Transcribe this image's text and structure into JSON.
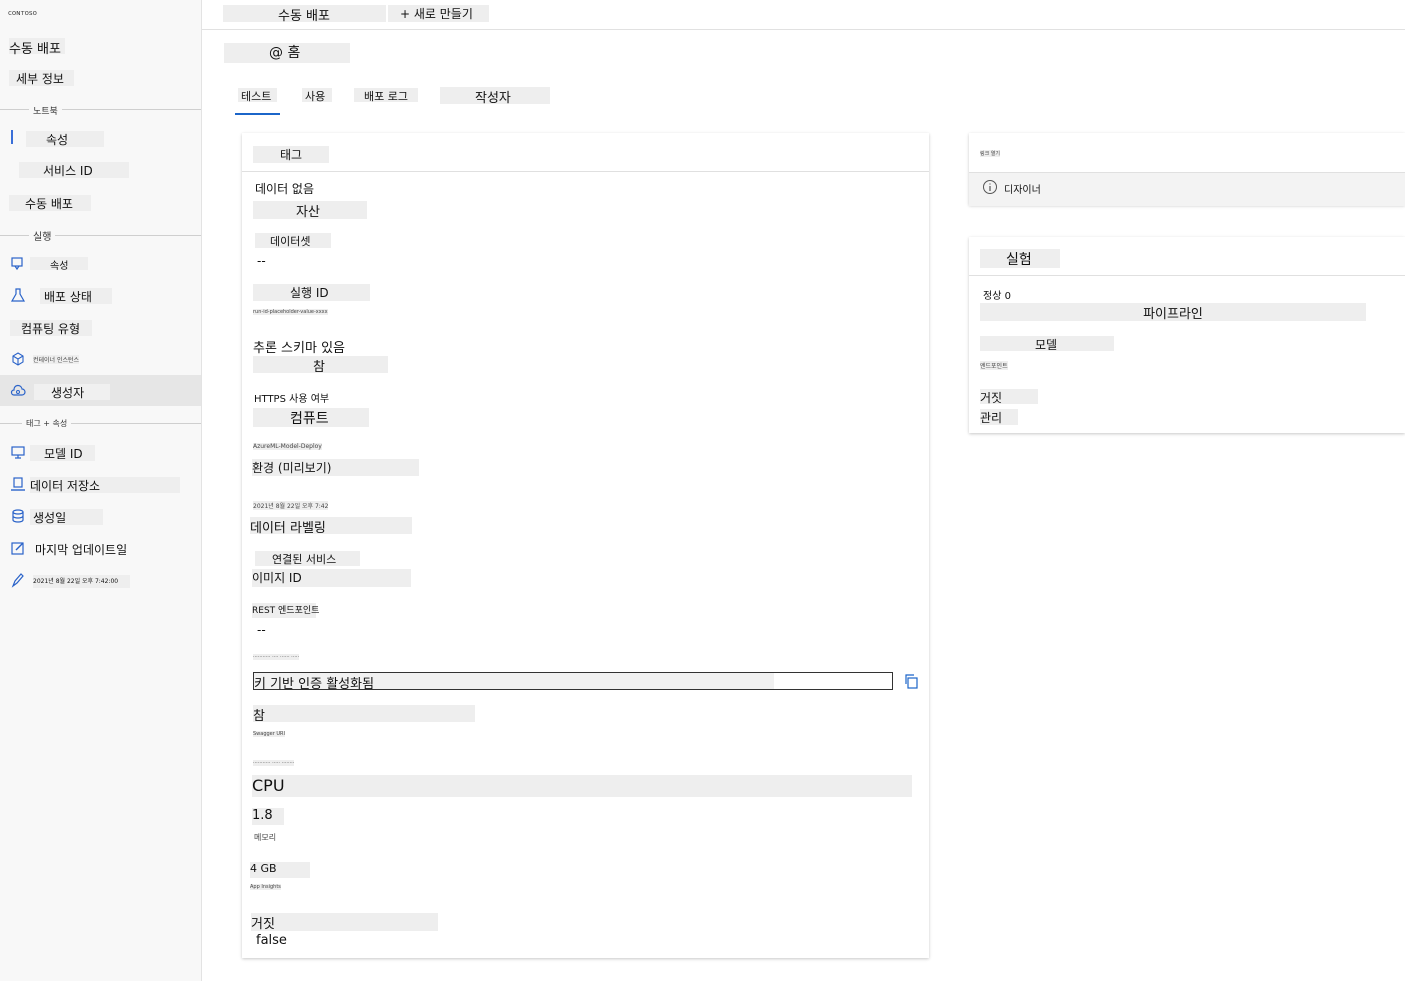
{
  "topbar": {
    "tab_title": "수동 배포",
    "new_button": "+ 새로 만들기"
  },
  "breadcrumb": {
    "home": "@ 홈"
  },
  "tabs": [
    "테스트",
    "사용",
    "배포 로그",
    "작성자"
  ],
  "sidebar": {
    "logo_text": "ᴄᴏɴᴛᴏsᴏ",
    "title": "수동 배포",
    "details": "세부 정보",
    "section_notebook": "노트북",
    "item_properties": "속성",
    "item_service_id": "서비스 ID",
    "item_manual_deploy": "수동 배포",
    "section_experiment": "실행",
    "item_attr": "속성",
    "item_deploy_state": "배포 상태",
    "item_compute_type": "컴퓨팅 유형",
    "item_tiny": "컨테이너 인스턴스",
    "item_creator": "생성자",
    "section_tag": "태그 + 속성",
    "item_model_id": "모델 ID",
    "item_datastore": "데이터 저장소",
    "item_created": "생성일",
    "item_last_updated": "마지막 업데이트일",
    "item_date": "2021년 8월 22일 오후 7:42:00"
  },
  "main_card": {
    "header": "태그",
    "no_data": "데이터 없음",
    "asset": "자산",
    "dataset": "데이터셋",
    "dash1": "--",
    "run_id": "실행 ID",
    "run_id_tiny": "run-id-placeholder-value-xxxx",
    "has_schema": "추론 스키마 있음",
    "true1": "참",
    "https_label": "HTTPS 사용 여부",
    "compute": "컴퓨트",
    "compute_tiny": "AzureML-Model-Deploy",
    "env": "환경 (미리보기)",
    "date_tiny": "2021년 8월 22일 오후 7:42",
    "labeling": "데이터 라벨링",
    "linked": "연결된 서비스",
    "image_id": "이미지 ID",
    "rest": "REST 엔드포인트",
    "dash2": "--",
    "tiny_before_key": "··········· ···· ······ ·····",
    "key_auth": "키 기반 인증 활성화됨",
    "true2": "참",
    "tiny_after_true": "Swagger URI",
    "tiny_before_cpu": "··········· ····· ········",
    "cpu": "CPU",
    "cpu_value": "1.8",
    "memory_tiny": "메모리",
    "mem_value": "4 GB",
    "tiny_after_mem": "App Insights",
    "false_label": "거짓",
    "false_value": "false"
  },
  "right_card1": {
    "tiny": "링크 열기",
    "designer": "디자이너"
  },
  "right_card2": {
    "title": "실험",
    "status": "정상 0",
    "pipeline": "파이프라인",
    "model": "모델",
    "tiny": "엔드포인트",
    "false": "거짓",
    "manage": "관리"
  }
}
